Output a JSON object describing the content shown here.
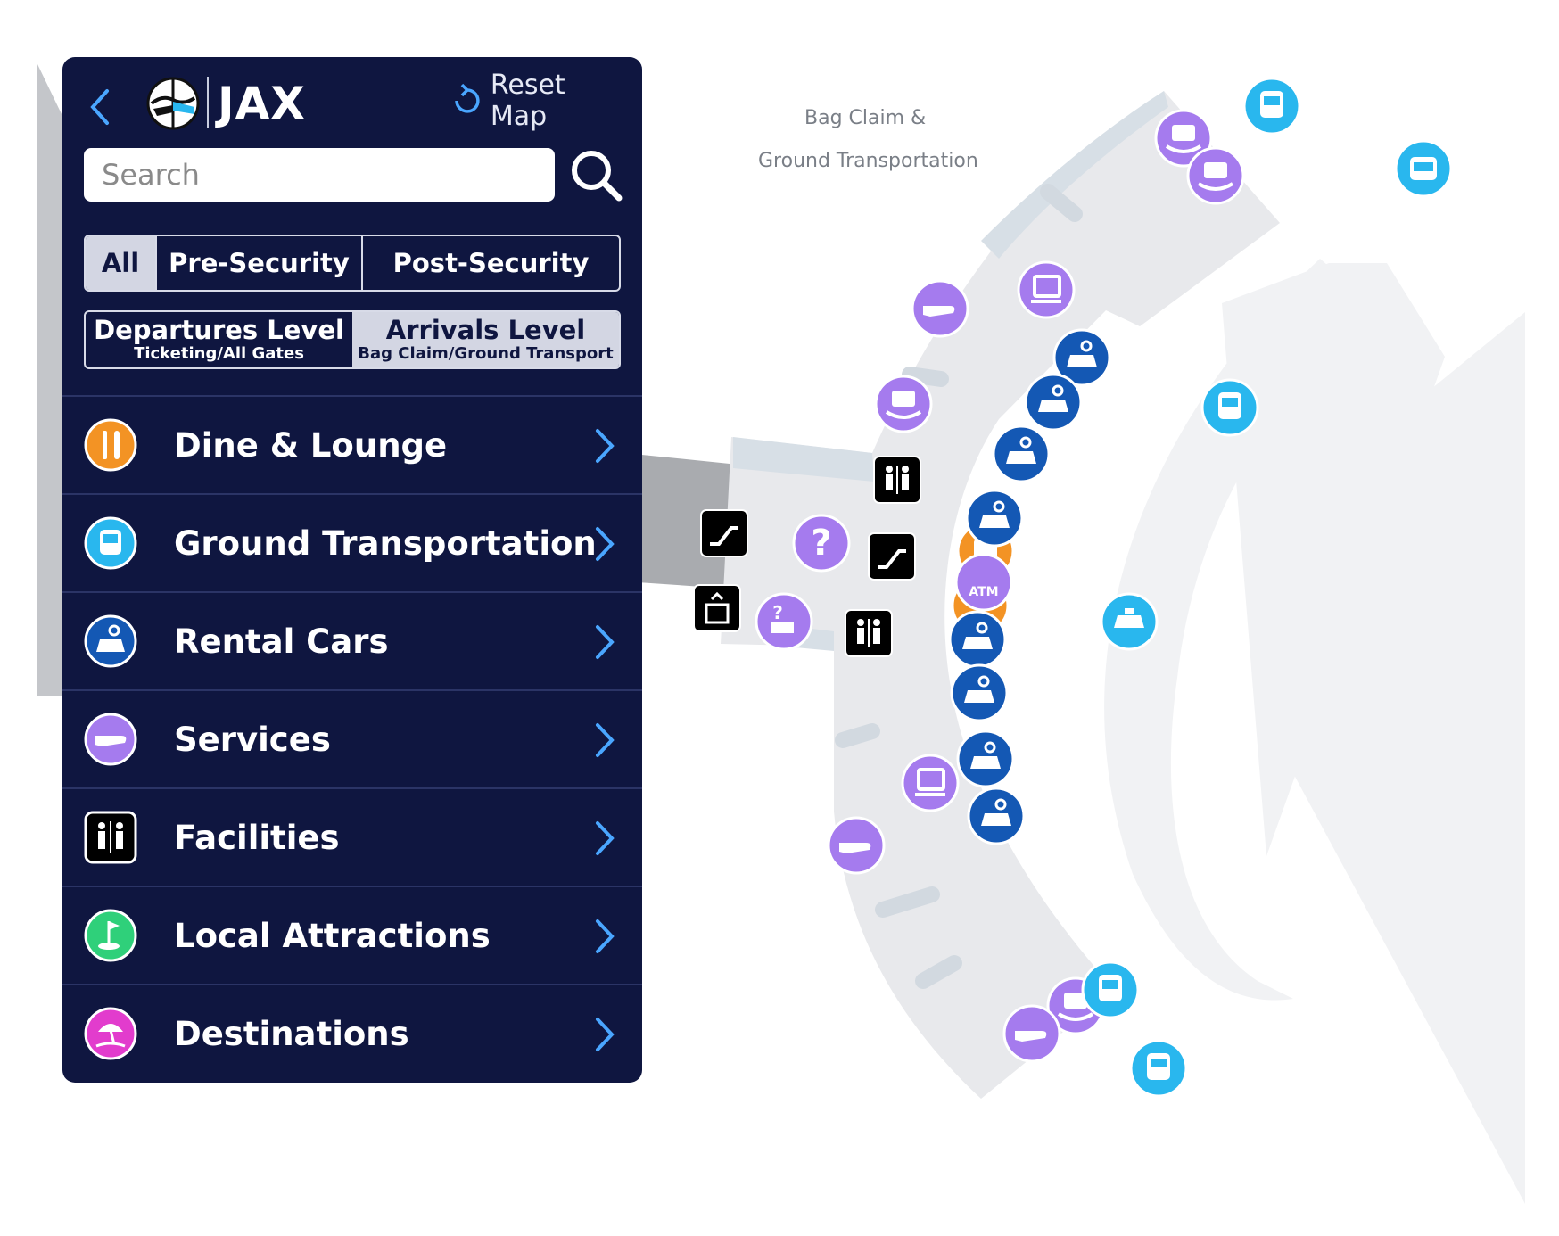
{
  "header": {
    "airport_code": "JAX",
    "reset_label": "Reset Map"
  },
  "search": {
    "placeholder": "Search"
  },
  "security_filter": {
    "options": [
      "All",
      "Pre-Security",
      "Post-Security"
    ],
    "selected": "All"
  },
  "levels": {
    "departures": {
      "title": "Departures Level",
      "subtitle": "Ticketing/All Gates"
    },
    "arrivals": {
      "title": "Arrivals Level",
      "subtitle": "Bag Claim/Ground Transport"
    },
    "selected": "Arrivals Level"
  },
  "categories": [
    {
      "label": "Dine & Lounge",
      "icon": "fork-knife-icon",
      "color": "#f39324"
    },
    {
      "label": "Ground Transportation",
      "icon": "bus-icon",
      "color": "#29b7ee"
    },
    {
      "label": "Rental Cars",
      "icon": "rental-car-icon",
      "color": "#1458b4"
    },
    {
      "label": "Services",
      "icon": "hand-icon",
      "color": "#a57bee"
    },
    {
      "label": "Facilities",
      "icon": "restroom-icon",
      "color": "#000000"
    },
    {
      "label": "Local Attractions",
      "icon": "golf-icon",
      "color": "#2fd07a"
    },
    {
      "label": "Destinations",
      "icon": "beach-umbrella-icon",
      "color": "#e23ccd"
    }
  ],
  "map": {
    "area_label_line1": "Bag Claim &",
    "area_label_line2": "Ground Transportation",
    "atm_label": "ATM"
  },
  "colors": {
    "panel": "#0f1640",
    "services": "#a57bee",
    "rental": "#1458b4",
    "transport": "#29b7ee",
    "dine": "#f39324",
    "terminal_floor": "#e8e9ec"
  }
}
